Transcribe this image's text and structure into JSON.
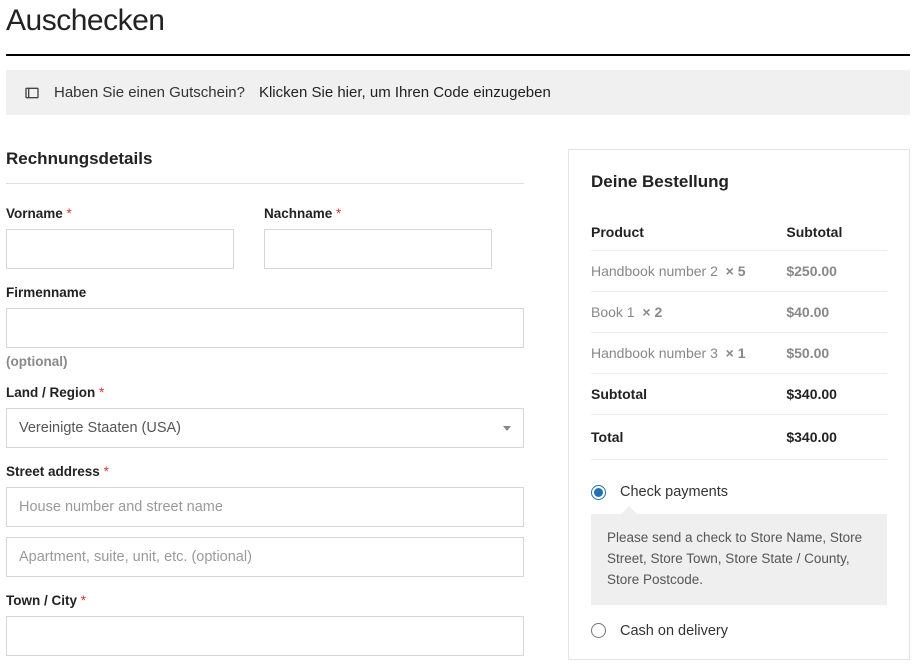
{
  "page_title": "Auschecken",
  "coupon": {
    "question": "Haben Sie einen Gutschein?",
    "link_text": "Klicken Sie hier, um Ihren Code einzugeben"
  },
  "billing": {
    "title": "Rechnungsdetails",
    "first_name_label": "Vorname",
    "last_name_label": "Nachname",
    "company_label": "Firmenname",
    "optional_text": "(optional)",
    "country_label": "Land / Region",
    "country_value": "Vereinigte Staaten (USA)",
    "street_label": "Street address",
    "street_ph1": "House number and street name",
    "street_ph2": "Apartment, suite, unit, etc. (optional)",
    "town_label": "Town / City",
    "required_mark": "*"
  },
  "order": {
    "title": "Deine Bestellung",
    "col_product": "Product",
    "col_subtotal": "Subtotal",
    "items": [
      {
        "name": "Handbook number 2",
        "qty": "× 5",
        "price": "$250.00"
      },
      {
        "name": "Book 1",
        "qty": "× 2",
        "price": "$40.00"
      },
      {
        "name": "Handbook number 3",
        "qty": "× 1",
        "price": "$50.00"
      }
    ],
    "subtotal_label": "Subtotal",
    "subtotal_value": "$340.00",
    "total_label": "Total",
    "total_value": "$340.00"
  },
  "payments": {
    "check_label": "Check payments",
    "check_desc": "Please send a check to Store Name, Store Street, Store Town, Store State / County, Store Postcode.",
    "cod_label": "Cash on delivery"
  }
}
